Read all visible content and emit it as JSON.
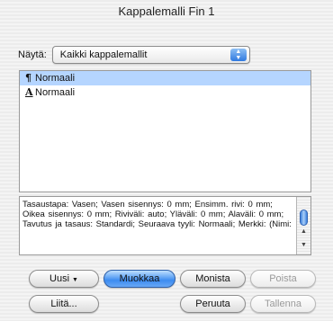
{
  "window": {
    "title": "Kappalemalli Fin 1"
  },
  "show": {
    "label": "Näytä:",
    "selected": "Kaikki kappalemallit",
    "arrows": "▲▼"
  },
  "styles": {
    "items": [
      {
        "icon": "¶",
        "icon_name": "paragraph-style-icon",
        "label": "Normaali",
        "selected": true
      },
      {
        "icon": "A",
        "icon_name": "character-style-icon",
        "label": "Normaali",
        "selected": false
      }
    ]
  },
  "description": {
    "text": "Tasaustapa: Vasen;  Vasen sisennys: 0 mm;  Ensimm. rivi: 0 mm;  Oikea sisennys: 0 mm;  Riviväli: auto; Yläväli: 0 mm;  Alaväli: 0 mm;  Tavutus ja tasaus: Standardi;  Seuraava tyyli: Normaali;  Merkki: (Nimi:"
  },
  "buttons": {
    "new": "Uusi",
    "new_caret": "▼",
    "edit": "Muokkaa",
    "copy": "Monista",
    "delete": "Poista",
    "append": "Liitä...",
    "cancel": "Peruuta",
    "save": "Tallenna"
  },
  "scroll": {
    "up": "▲",
    "down": "▼"
  }
}
